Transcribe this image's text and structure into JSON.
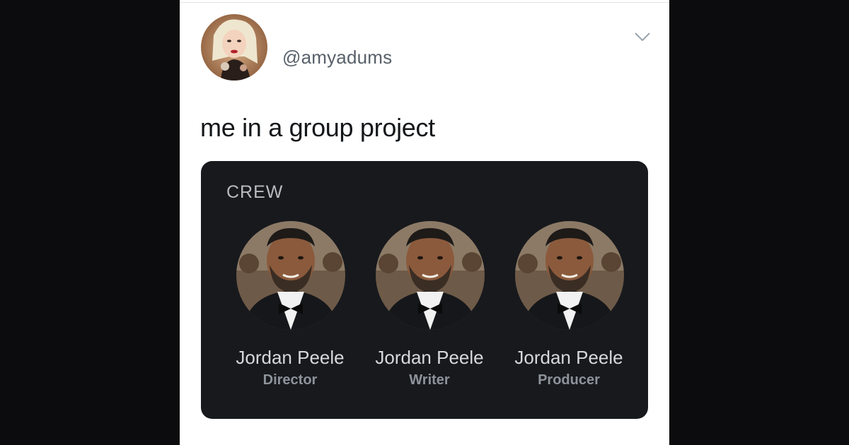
{
  "tweet": {
    "handle": "@amyadums",
    "text": "me in a group project",
    "menu_icon": "chevron-down-icon"
  },
  "crew": {
    "heading": "CREW",
    "members": [
      {
        "name": "Jordan Peele",
        "role": "Director"
      },
      {
        "name": "Jordan Peele",
        "role": "Writer"
      },
      {
        "name": "Jordan Peele",
        "role": "Producer"
      }
    ]
  },
  "colors": {
    "page_background": "#0c0c0e",
    "card_background": "#ffffff",
    "panel_background": "#17191d"
  }
}
